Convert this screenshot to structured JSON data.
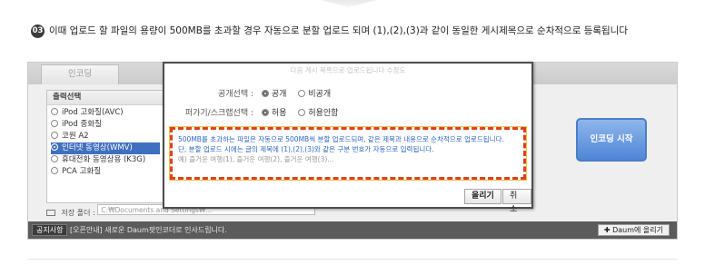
{
  "step": {
    "number": "03",
    "text": "이때 업로드 할 파일의 용량이 500MB를 초과할 경우 자동으로 분할 업로드 되며 (1),(2),(3)과 같이 동일한 게시제목으로 순차적으로 등록됩니다"
  },
  "app": {
    "tab_label": "인코딩",
    "output_panel": {
      "title": "출력선택",
      "options": [
        {
          "label": "iPod 고화질(AVC)",
          "selected": false
        },
        {
          "label": "iPod 중화질",
          "selected": false
        },
        {
          "label": "코원 A2",
          "selected": false
        },
        {
          "label": "인터넷 동영상(WMV)",
          "selected": true
        },
        {
          "label": "휴대전화 동영상용 (K3G)",
          "selected": false
        },
        {
          "label": "PCA 고화질",
          "selected": false
        }
      ]
    },
    "save_folder": {
      "label": "저장 폴더 :",
      "path": "C:₩Documents and Settings₩..."
    },
    "encode_button": "인코딩 시작",
    "footer": {
      "notice_badge": "공지사항",
      "notice_text": "[오픈안내] 새로운 Daum팟인코더로 인사드립니다.",
      "upload_button": "Daum에 올리기"
    }
  },
  "dialog": {
    "faded_text": "다음 게시 목록으로 업로드됩니다 수정도",
    "visibility": {
      "label": "공개선택 :",
      "options": [
        {
          "label": "공개",
          "selected": true
        },
        {
          "label": "비공개",
          "selected": false
        }
      ]
    },
    "scrap": {
      "label": "퍼가기/스크랩선택 :",
      "options": [
        {
          "label": "허용",
          "selected": true
        },
        {
          "label": "허용안함",
          "selected": false
        }
      ]
    },
    "info": {
      "line1": "500MB를 초과하는 파일은 자동으로 500MB씩 분할 업로드되며, 같은 제목과 내용으로 순차적으로 업로드됩니다.",
      "line2": "단, 분할 업로드 시에는 글의 제목에 (1),(2),(3)와 같은 구분 번호가 자동으로 입력됩니다.",
      "line3": "예) 즐거운 여행(1), 즐거운 여행(2), 즐거운 여행(3)..."
    },
    "ok_button": "올리기",
    "cancel_button": "취소"
  },
  "colors": {
    "accent_blue": "#3f6fbf",
    "highlight_border": "#e04017",
    "info_text": "#2e67c6"
  }
}
